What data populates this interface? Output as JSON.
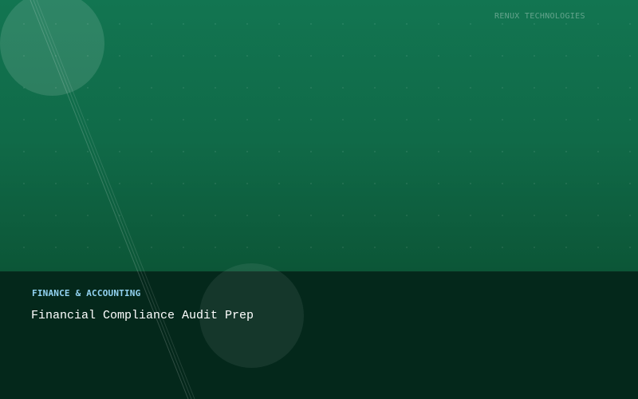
{
  "brand": "RENUX TECHNOLOGIES",
  "category": "FINANCE & ACCOUNTING",
  "title": "Financial Compliance Audit Prep",
  "colors": {
    "top_gradient": "#127551",
    "bottom_band": "#04281b",
    "category_text": "#93d3f1",
    "title_text": "#ffffff"
  }
}
